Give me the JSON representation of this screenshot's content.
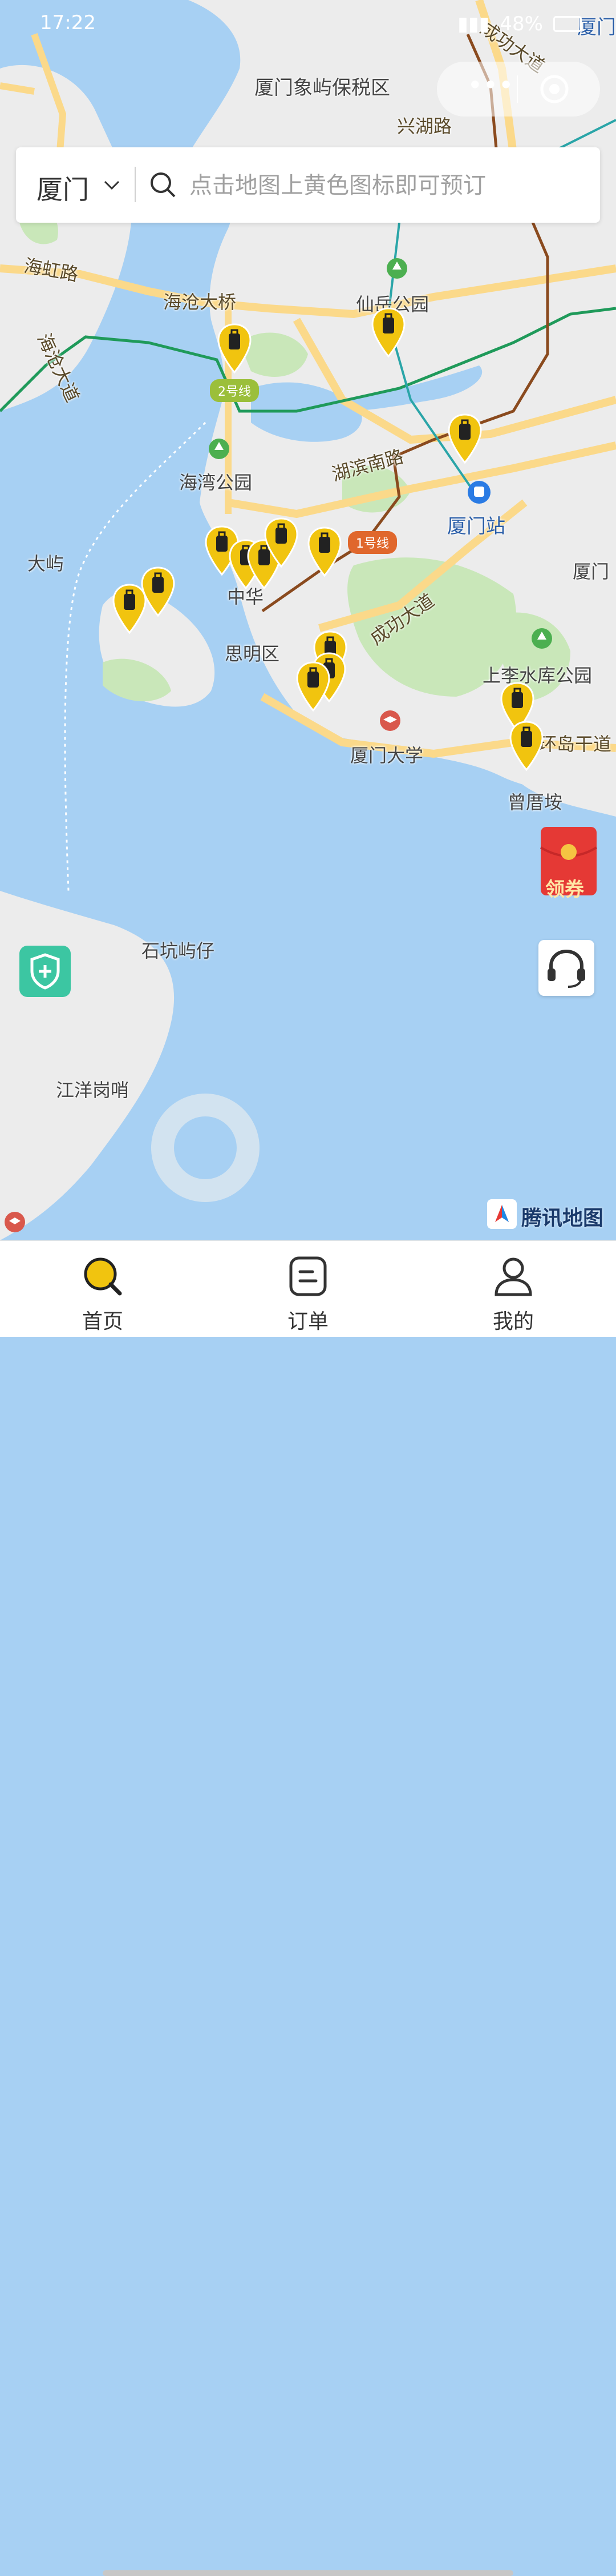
{
  "status_bar": {
    "time": "17:22",
    "battery": "48%"
  },
  "search": {
    "city": "厦门",
    "placeholder": "点击地图上黄色图标即可预订"
  },
  "map": {
    "labels": {
      "free_trade_zone": "厦门象屿保税区",
      "xinghu_road": "兴湖路",
      "chenggong_avenue_top": "成功大道",
      "gaoqi": "厦门国际",
      "haihong_road": "海虹路",
      "haicang_bridge": "海沧大桥",
      "haicang_avenue": "海沧大道",
      "xianyue_park": "仙岳公园",
      "line2": "2号线",
      "bay_park": "海湾公园",
      "hubin_south_road": "湖滨南路",
      "xiamen_station": "厦门站",
      "dayu": "大屿",
      "line1": "1号线",
      "zhongshan": "中华",
      "siming_district": "思明区",
      "chenggong_avenue": "成功大道",
      "shanglixi_park": "上李水库公园",
      "huandao_road": "环岛干道",
      "xiamen_university": "厦门大学",
      "zengcuoan": "曾厝垵",
      "xiamen_right": "厦门",
      "shikeng": "石坑屿仔",
      "jiangyang": "江洋岗哨",
      "haicang_avenue2": "道"
    },
    "pin_icon": "luggage-icon",
    "brand": "腾讯地图"
  },
  "float": {
    "coupon": "领券"
  },
  "tabs": [
    {
      "label": "首页",
      "icon": "search-icon"
    },
    {
      "label": "订单",
      "icon": "order-icon"
    },
    {
      "label": "我的",
      "icon": "user-icon"
    }
  ],
  "colors": {
    "pin": "#f1c40f",
    "water": "#a7d0f3",
    "land": "#ececec",
    "park": "#c9e7b9",
    "road": "#fbd98a",
    "metro2": "#1f9a5a",
    "metro1": "#8a4a1e"
  }
}
